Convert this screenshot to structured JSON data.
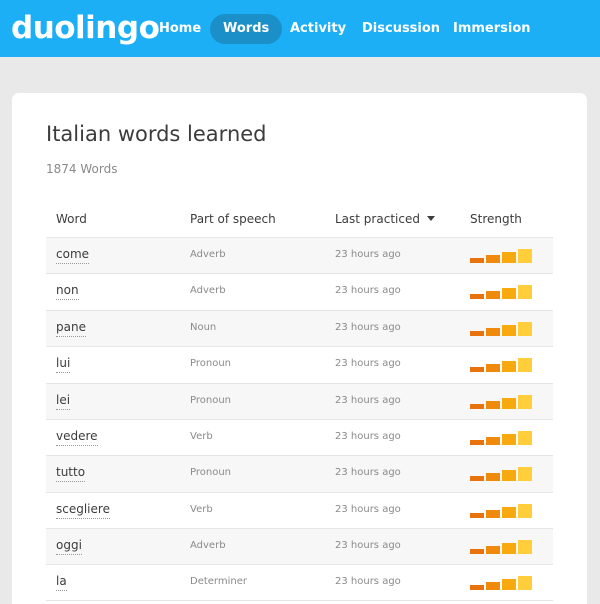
{
  "app": {
    "logo_text": "duolingo",
    "nav": [
      {
        "label": "Home",
        "active": false
      },
      {
        "label": "Words",
        "active": true
      },
      {
        "label": "Activity",
        "active": false
      },
      {
        "label": "Discussion",
        "active": false
      },
      {
        "label": "Immersion",
        "active": false
      }
    ],
    "brand_color": "#1caff6"
  },
  "page": {
    "title": "Italian words learned",
    "word_count": "1874 Words"
  },
  "table": {
    "columns": [
      "Word",
      "Part of speech",
      "Last practiced",
      "Strength"
    ],
    "sorted_by": "Last practiced",
    "rows": [
      {
        "word": "come",
        "pos": "Adverb",
        "last": "23 hours ago",
        "strength": 4
      },
      {
        "word": "non",
        "pos": "Adverb",
        "last": "23 hours ago",
        "strength": 4
      },
      {
        "word": "pane",
        "pos": "Noun",
        "last": "23 hours ago",
        "strength": 4
      },
      {
        "word": "lui",
        "pos": "Pronoun",
        "last": "23 hours ago",
        "strength": 4
      },
      {
        "word": "lei",
        "pos": "Pronoun",
        "last": "23 hours ago",
        "strength": 4
      },
      {
        "word": "vedere",
        "pos": "Verb",
        "last": "23 hours ago",
        "strength": 4
      },
      {
        "word": "tutto",
        "pos": "Pronoun",
        "last": "23 hours ago",
        "strength": 4
      },
      {
        "word": "scegliere",
        "pos": "Verb",
        "last": "23 hours ago",
        "strength": 4
      },
      {
        "word": "oggi",
        "pos": "Adverb",
        "last": "23 hours ago",
        "strength": 4
      },
      {
        "word": "la",
        "pos": "Determiner",
        "last": "23 hours ago",
        "strength": 4
      }
    ]
  },
  "strength_colors": [
    "#e8720c",
    "#f08a0c",
    "#f8a90e",
    "#ffce3a"
  ]
}
